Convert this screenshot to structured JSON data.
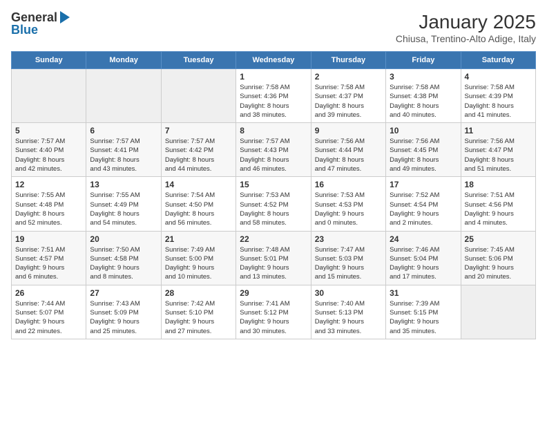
{
  "logo": {
    "general": "General",
    "blue": "Blue"
  },
  "title": "January 2025",
  "subtitle": "Chiusa, Trentino-Alto Adige, Italy",
  "weekdays": [
    "Sunday",
    "Monday",
    "Tuesday",
    "Wednesday",
    "Thursday",
    "Friday",
    "Saturday"
  ],
  "weeks": [
    [
      {
        "day": "",
        "info": ""
      },
      {
        "day": "",
        "info": ""
      },
      {
        "day": "",
        "info": ""
      },
      {
        "day": "1",
        "info": "Sunrise: 7:58 AM\nSunset: 4:36 PM\nDaylight: 8 hours\nand 38 minutes."
      },
      {
        "day": "2",
        "info": "Sunrise: 7:58 AM\nSunset: 4:37 PM\nDaylight: 8 hours\nand 39 minutes."
      },
      {
        "day": "3",
        "info": "Sunrise: 7:58 AM\nSunset: 4:38 PM\nDaylight: 8 hours\nand 40 minutes."
      },
      {
        "day": "4",
        "info": "Sunrise: 7:58 AM\nSunset: 4:39 PM\nDaylight: 8 hours\nand 41 minutes."
      }
    ],
    [
      {
        "day": "5",
        "info": "Sunrise: 7:57 AM\nSunset: 4:40 PM\nDaylight: 8 hours\nand 42 minutes."
      },
      {
        "day": "6",
        "info": "Sunrise: 7:57 AM\nSunset: 4:41 PM\nDaylight: 8 hours\nand 43 minutes."
      },
      {
        "day": "7",
        "info": "Sunrise: 7:57 AM\nSunset: 4:42 PM\nDaylight: 8 hours\nand 44 minutes."
      },
      {
        "day": "8",
        "info": "Sunrise: 7:57 AM\nSunset: 4:43 PM\nDaylight: 8 hours\nand 46 minutes."
      },
      {
        "day": "9",
        "info": "Sunrise: 7:56 AM\nSunset: 4:44 PM\nDaylight: 8 hours\nand 47 minutes."
      },
      {
        "day": "10",
        "info": "Sunrise: 7:56 AM\nSunset: 4:45 PM\nDaylight: 8 hours\nand 49 minutes."
      },
      {
        "day": "11",
        "info": "Sunrise: 7:56 AM\nSunset: 4:47 PM\nDaylight: 8 hours\nand 51 minutes."
      }
    ],
    [
      {
        "day": "12",
        "info": "Sunrise: 7:55 AM\nSunset: 4:48 PM\nDaylight: 8 hours\nand 52 minutes."
      },
      {
        "day": "13",
        "info": "Sunrise: 7:55 AM\nSunset: 4:49 PM\nDaylight: 8 hours\nand 54 minutes."
      },
      {
        "day": "14",
        "info": "Sunrise: 7:54 AM\nSunset: 4:50 PM\nDaylight: 8 hours\nand 56 minutes."
      },
      {
        "day": "15",
        "info": "Sunrise: 7:53 AM\nSunset: 4:52 PM\nDaylight: 8 hours\nand 58 minutes."
      },
      {
        "day": "16",
        "info": "Sunrise: 7:53 AM\nSunset: 4:53 PM\nDaylight: 9 hours\nand 0 minutes."
      },
      {
        "day": "17",
        "info": "Sunrise: 7:52 AM\nSunset: 4:54 PM\nDaylight: 9 hours\nand 2 minutes."
      },
      {
        "day": "18",
        "info": "Sunrise: 7:51 AM\nSunset: 4:56 PM\nDaylight: 9 hours\nand 4 minutes."
      }
    ],
    [
      {
        "day": "19",
        "info": "Sunrise: 7:51 AM\nSunset: 4:57 PM\nDaylight: 9 hours\nand 6 minutes."
      },
      {
        "day": "20",
        "info": "Sunrise: 7:50 AM\nSunset: 4:58 PM\nDaylight: 9 hours\nand 8 minutes."
      },
      {
        "day": "21",
        "info": "Sunrise: 7:49 AM\nSunset: 5:00 PM\nDaylight: 9 hours\nand 10 minutes."
      },
      {
        "day": "22",
        "info": "Sunrise: 7:48 AM\nSunset: 5:01 PM\nDaylight: 9 hours\nand 13 minutes."
      },
      {
        "day": "23",
        "info": "Sunrise: 7:47 AM\nSunset: 5:03 PM\nDaylight: 9 hours\nand 15 minutes."
      },
      {
        "day": "24",
        "info": "Sunrise: 7:46 AM\nSunset: 5:04 PM\nDaylight: 9 hours\nand 17 minutes."
      },
      {
        "day": "25",
        "info": "Sunrise: 7:45 AM\nSunset: 5:06 PM\nDaylight: 9 hours\nand 20 minutes."
      }
    ],
    [
      {
        "day": "26",
        "info": "Sunrise: 7:44 AM\nSunset: 5:07 PM\nDaylight: 9 hours\nand 22 minutes."
      },
      {
        "day": "27",
        "info": "Sunrise: 7:43 AM\nSunset: 5:09 PM\nDaylight: 9 hours\nand 25 minutes."
      },
      {
        "day": "28",
        "info": "Sunrise: 7:42 AM\nSunset: 5:10 PM\nDaylight: 9 hours\nand 27 minutes."
      },
      {
        "day": "29",
        "info": "Sunrise: 7:41 AM\nSunset: 5:12 PM\nDaylight: 9 hours\nand 30 minutes."
      },
      {
        "day": "30",
        "info": "Sunrise: 7:40 AM\nSunset: 5:13 PM\nDaylight: 9 hours\nand 33 minutes."
      },
      {
        "day": "31",
        "info": "Sunrise: 7:39 AM\nSunset: 5:15 PM\nDaylight: 9 hours\nand 35 minutes."
      },
      {
        "day": "",
        "info": ""
      }
    ]
  ]
}
